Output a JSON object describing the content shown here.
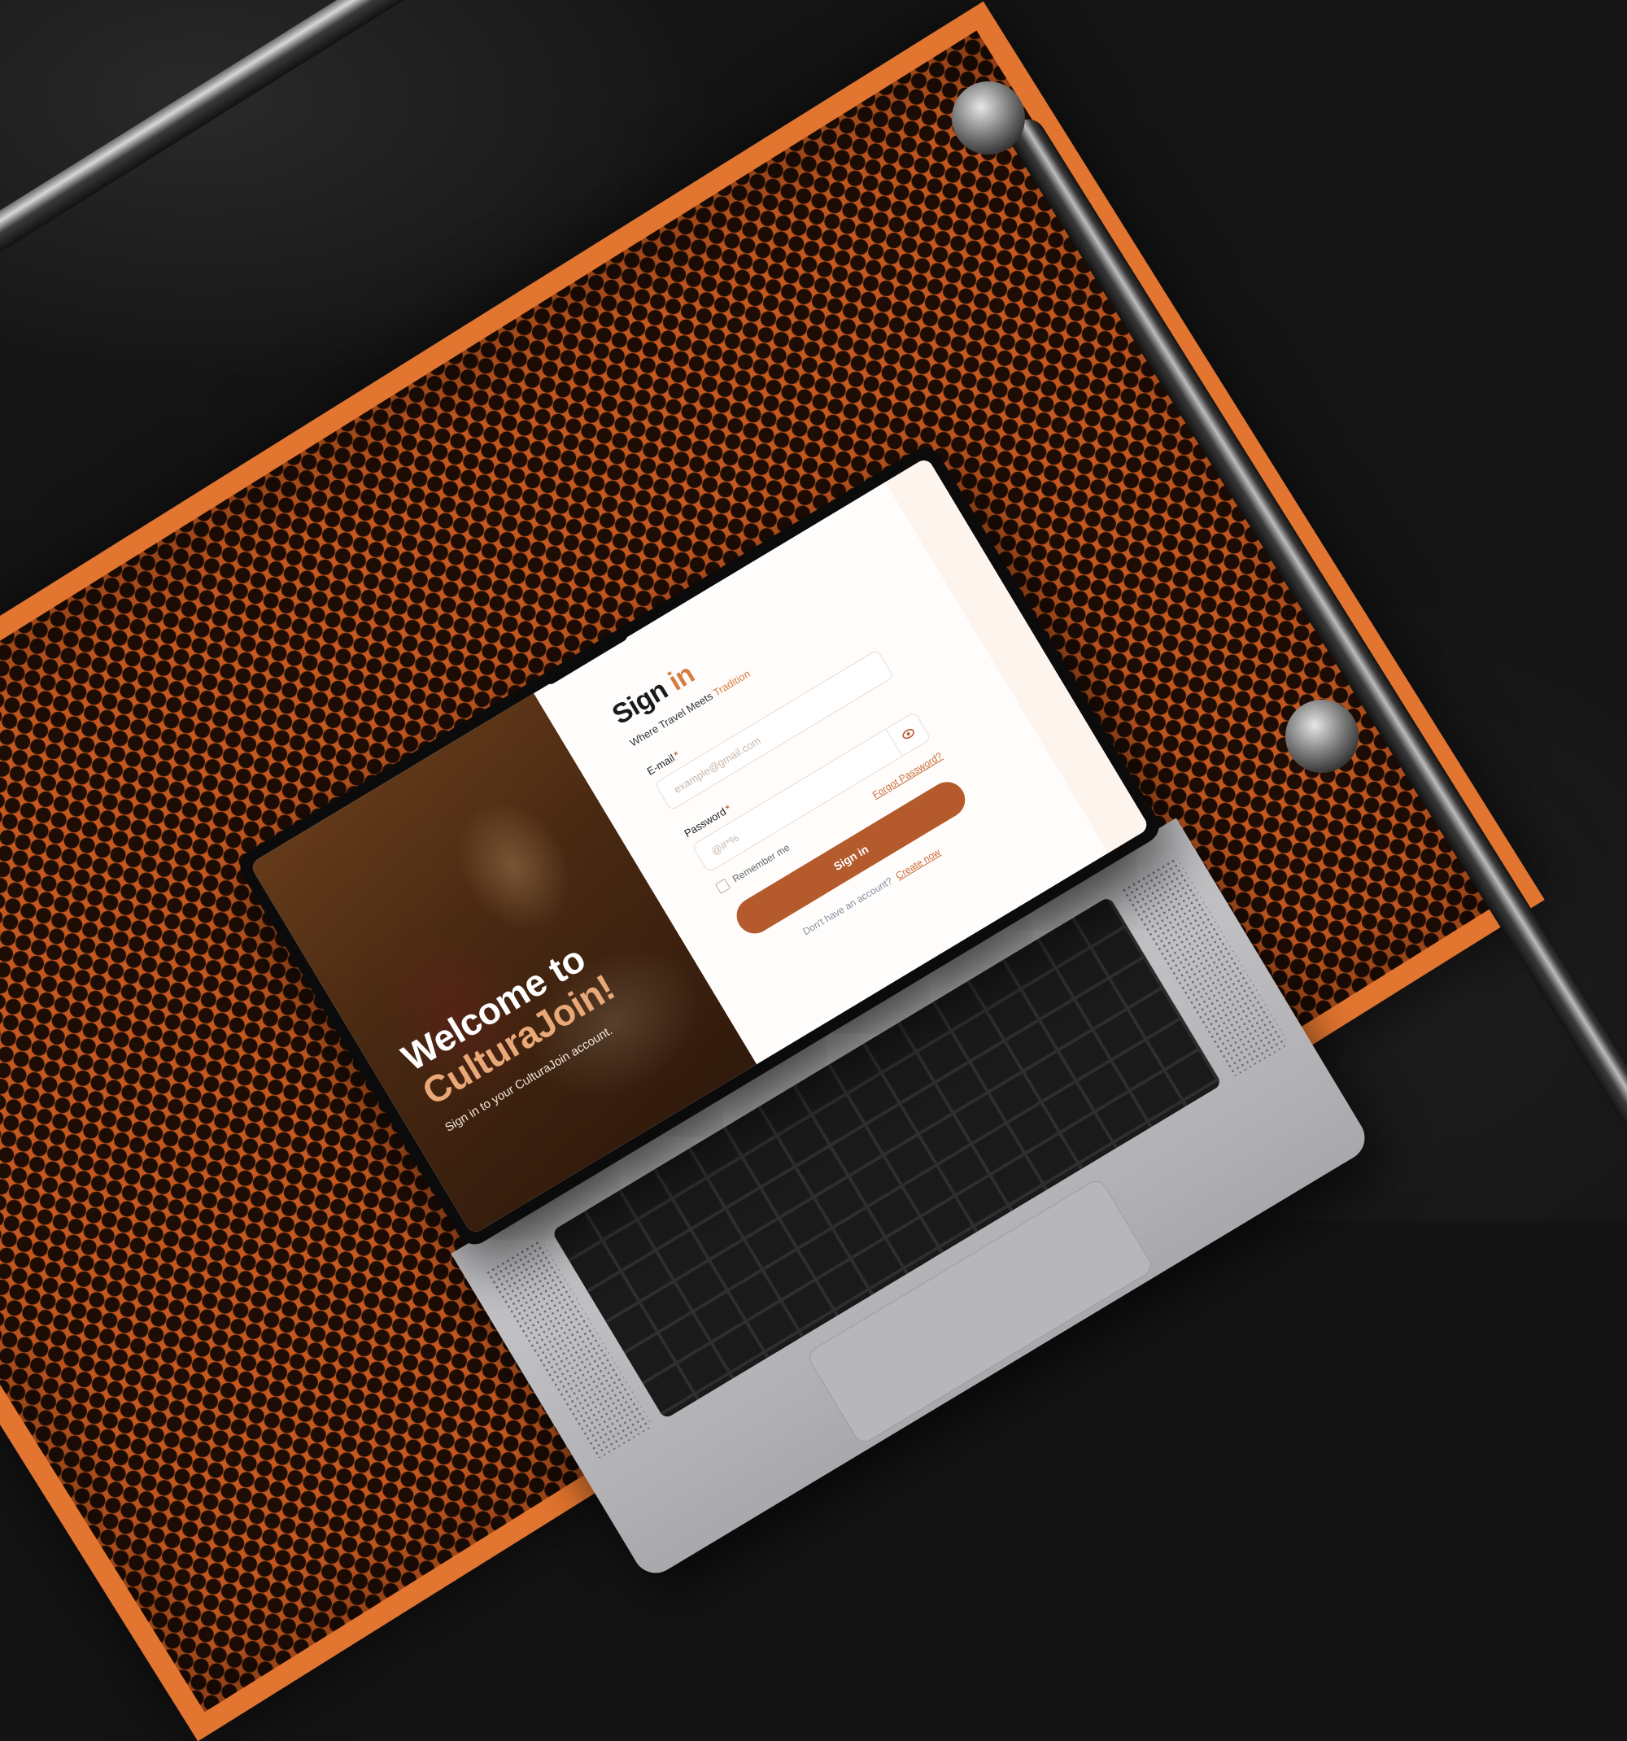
{
  "signin": {
    "title_main": "Sign",
    "title_accent": "in",
    "tagline_main": "Where Travel Meets",
    "tagline_accent": "Tradition",
    "email": {
      "label": "E-mail",
      "required_mark": "*",
      "placeholder": "example@gmail.com"
    },
    "password": {
      "label": "Password",
      "required_mark": "*",
      "placeholder": "@#*%"
    },
    "remember_label": "Remember me",
    "forgot_label": "Forgot Password?",
    "submit_label": "Sign in",
    "signup_prompt": "Don't have an account?",
    "signup_link": "Create now"
  },
  "hero": {
    "title_line1": "Welcome to",
    "title_brand": "CulturaJoin!",
    "subtitle": "Sign in to your CulturaJoin account."
  },
  "theme": {
    "accent": "#d77b42",
    "button": "#b55a2d",
    "frame": "#e2752f"
  }
}
